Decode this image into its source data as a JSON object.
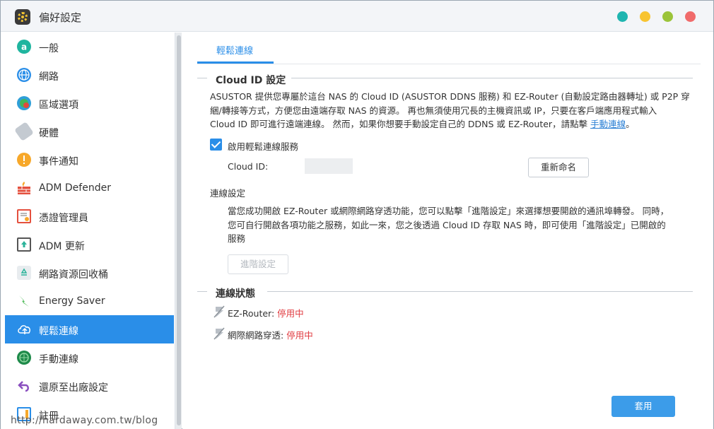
{
  "window": {
    "title": "偏好設定"
  },
  "colors": {
    "accent": "#2a8ee8",
    "disabled_status": "#e0393e"
  },
  "sidebar": {
    "items": [
      {
        "label": "一般",
        "icon": "general-icon"
      },
      {
        "label": "網路",
        "icon": "globe-network-icon"
      },
      {
        "label": "區域選項",
        "icon": "region-icon"
      },
      {
        "label": "硬體",
        "icon": "hardware-icon"
      },
      {
        "label": "事件通知",
        "icon": "alert-icon"
      },
      {
        "label": "ADM Defender",
        "icon": "firewall-icon"
      },
      {
        "label": "憑證管理員",
        "icon": "certificate-icon"
      },
      {
        "label": "ADM 更新",
        "icon": "update-icon"
      },
      {
        "label": "網路資源回收桶",
        "icon": "recycle-bin-icon"
      },
      {
        "label": "Energy Saver",
        "icon": "energy-icon"
      },
      {
        "label": "輕鬆連線",
        "icon": "cloud-connect-icon",
        "active": true
      },
      {
        "label": "手動連線",
        "icon": "manual-connect-icon"
      },
      {
        "label": "還原至出廠設定",
        "icon": "restore-icon"
      },
      {
        "label": "註冊",
        "icon": "register-icon"
      }
    ]
  },
  "main": {
    "tab_label": "輕鬆連線",
    "cloud_section": {
      "title": "Cloud ID 設定",
      "desc_line1": "ASUSTOR 提供您專屬於這台 NAS 的 Cloud ID (ASUSTOR DDNS 服務) 和 EZ-Router (自動設定路由器轉址) 或 P2P 穿",
      "desc_line2": "綑/轉接等方式，方便您由遠端存取 NAS 的資源。 再也無須使用冗長的主機資訊或 IP，只要在客戶端應用程式輸入",
      "desc_line3": "Cloud ID 即可進行遠端連線。 然而，如果你想要手動設定自己的 DDNS 或  EZ-Router，請點擊",
      "desc_link": "手動連線",
      "desc_end": "。",
      "enable_label": "啟用輕鬆連線服務",
      "enable_checked": true,
      "cloud_id_label": "Cloud ID:",
      "rename_button": "重新命名",
      "conn_settings_label": "連線設定",
      "conn_desc_line1": "當您成功開啟 EZ-Router 或網際網路穿透功能，您可以點擊「進階設定」來選擇想要開啟的通訊埠轉發。 同時，",
      "conn_desc_line2": "您可自行開啟各項功能之服務，如此一來，您之後透過 Cloud ID 存取 NAS 時，即可使用「進階設定」已開啟的",
      "conn_desc_line3": "服務",
      "advanced_button": "進階設定"
    },
    "status_section": {
      "title": "連線狀態",
      "rows": [
        {
          "label": "EZ-Router:",
          "value": "停用中"
        },
        {
          "label": "網際網路穿透:",
          "value": "停用中"
        }
      ]
    },
    "apply_button": "套用"
  },
  "watermark": "http://hardaway.com.tw/blog"
}
